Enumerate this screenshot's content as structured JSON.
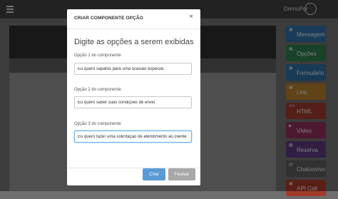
{
  "topbar": {
    "user_name": "DemoPor"
  },
  "sidebar": {
    "items": [
      {
        "label": "Mensagem",
        "color": "#2d6ea2",
        "icon": "message-icon"
      },
      {
        "label": "Opções",
        "color": "#2f7a4a",
        "icon": "options-icon"
      },
      {
        "label": "Formulário",
        "color": "#2e6a9a",
        "icon": "form-icon"
      },
      {
        "label": "Link",
        "color": "#b07a2a",
        "icon": "link-icon"
      },
      {
        "label": "HTML",
        "color": "#9a3a2e",
        "icon": "code-icon"
      },
      {
        "label": "Vídeo",
        "color": "#8a2f5a",
        "icon": "video-icon"
      },
      {
        "label": "Reserva",
        "color": "#5a3a7a",
        "icon": "calendar-icon"
      },
      {
        "label": "Chatoovivo",
        "color": "#5a5a5a",
        "icon": "chat-icon"
      },
      {
        "label": "API Call",
        "color": "#a33a2a",
        "icon": "api-icon"
      }
    ]
  },
  "modal": {
    "title": "CRIAR COMPONENTE OPÇÃO",
    "close_icon": "×",
    "heading": "Digite as opções a serem exibidas",
    "fields": [
      {
        "label": "Opção 1 do componente",
        "value": "Eu quero sapatos para uma ocasião especial."
      },
      {
        "label": "Opção 2 do componente",
        "value": "Eu quero saber suas condições de envio"
      },
      {
        "label": "Opção 3 do componente",
        "value": "Eu quero fazer uma solicitação de atendimento ao cliente"
      }
    ],
    "primary_button": "Criar",
    "secondary_button": "Fechar"
  }
}
